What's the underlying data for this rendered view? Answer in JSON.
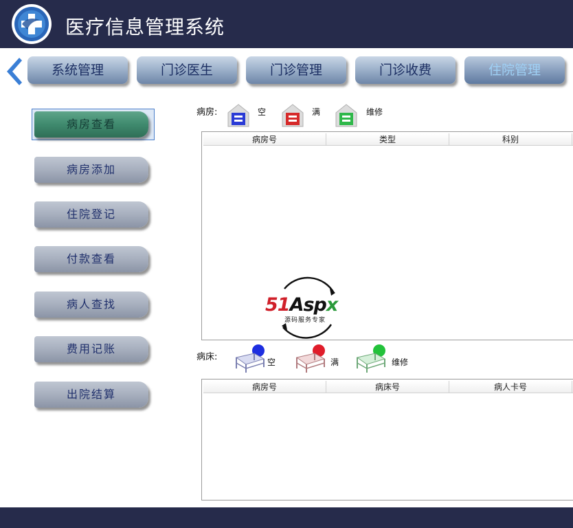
{
  "header": {
    "title": "医疗信息管理系统",
    "logo_icon": "medical-cross-logo-icon"
  },
  "nav": {
    "back_icon": "chevron-left-icon",
    "tabs": [
      {
        "label": "系统管理"
      },
      {
        "label": "门诊医生"
      },
      {
        "label": "门诊管理"
      },
      {
        "label": "门诊收费"
      },
      {
        "label": "住院管理",
        "active": true
      }
    ]
  },
  "sidebar": {
    "items": [
      {
        "label": "病房查看",
        "active": true
      },
      {
        "label": "病房添加"
      },
      {
        "label": "住院登记"
      },
      {
        "label": "付款查看"
      },
      {
        "label": "病人查找"
      },
      {
        "label": "费用记账"
      },
      {
        "label": "出院结算"
      }
    ]
  },
  "ward_legend": {
    "label": "病房:",
    "items": [
      {
        "label": "空",
        "color": "#2a3bd6"
      },
      {
        "label": "满",
        "color": "#d62a2a"
      },
      {
        "label": "维修",
        "color": "#2fb84a"
      }
    ]
  },
  "ward_table": {
    "columns": [
      "病房号",
      "类型",
      "科别"
    ]
  },
  "bed_legend": {
    "label": "病床:",
    "items": [
      {
        "label": "空",
        "color": "#1d2ee0"
      },
      {
        "label": "满",
        "color": "#e01d2a"
      },
      {
        "label": "维修",
        "color": "#22c23a"
      }
    ]
  },
  "bed_table": {
    "columns": [
      "病房号",
      "病床号",
      "病人卡号"
    ]
  },
  "watermark": {
    "brand": "51Aspx",
    "tagline": "源码服务专家"
  },
  "colors": {
    "header_bg": "#262b4b",
    "nav_text": "#1c2f63",
    "active_nav_text": "#9fd0f5",
    "sidebar_text": "#1f2f6b",
    "sidebar_active": "#3f8a6e"
  }
}
